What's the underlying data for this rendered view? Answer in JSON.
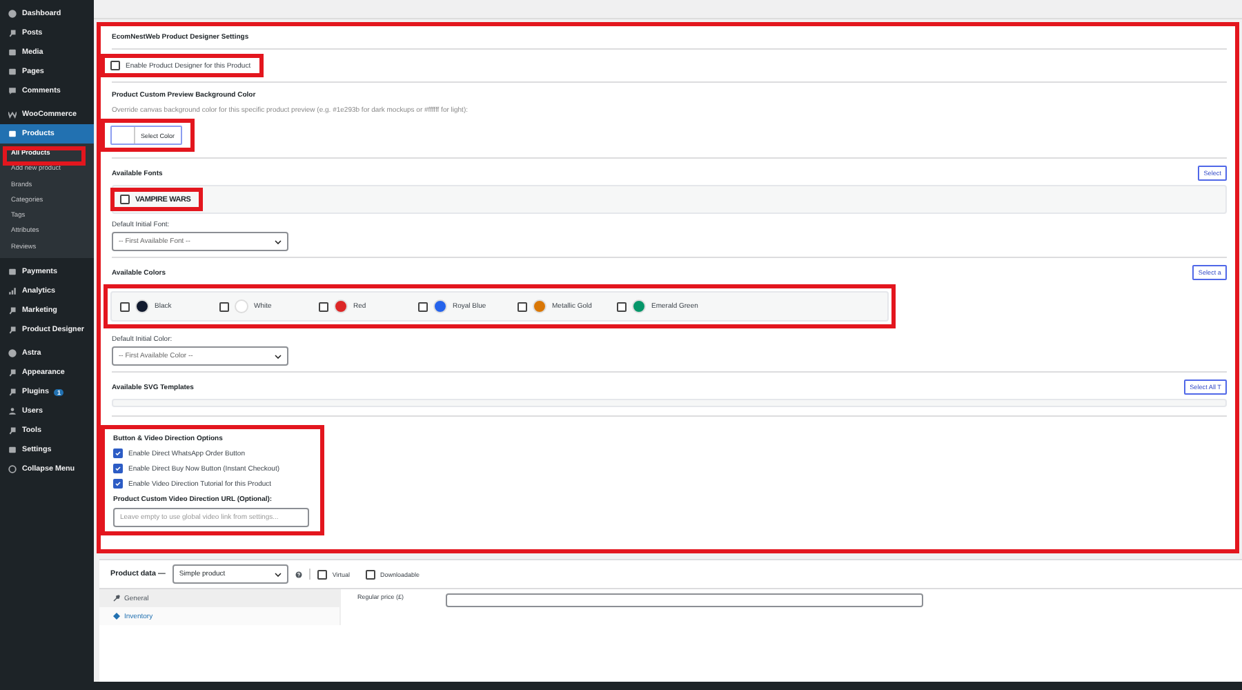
{
  "sidebar": {
    "items": [
      {
        "label": "Dashboard",
        "selected": false
      },
      {
        "label": "Posts",
        "selected": false
      },
      {
        "label": "Media",
        "selected": false
      },
      {
        "label": "Pages",
        "selected": false
      },
      {
        "label": "Comments",
        "selected": false
      },
      {
        "label": "WooCommerce",
        "selected": false
      },
      {
        "label": "Products",
        "selected": true,
        "children": [
          {
            "label": "All Products",
            "selected": true
          },
          {
            "label": "Add new product",
            "selected": false
          },
          {
            "label": "Brands",
            "selected": false
          },
          {
            "label": "Categories",
            "selected": false
          },
          {
            "label": "Tags",
            "selected": false
          },
          {
            "label": "Attributes",
            "selected": false
          },
          {
            "label": "Reviews",
            "selected": false
          }
        ]
      },
      {
        "label": "Payments",
        "selected": false
      },
      {
        "label": "Analytics",
        "selected": false
      },
      {
        "label": "Marketing",
        "selected": false
      },
      {
        "label": "Product Designer",
        "selected": false
      },
      {
        "label": "Astra",
        "selected": false
      },
      {
        "label": "Appearance",
        "selected": false
      },
      {
        "label": "Plugins",
        "selected": false,
        "badge": "1"
      },
      {
        "label": "Users",
        "selected": false
      },
      {
        "label": "Tools",
        "selected": false
      },
      {
        "label": "Settings",
        "selected": false
      },
      {
        "label": "Collapse Menu",
        "selected": false
      }
    ]
  },
  "panel": {
    "title": "EcomNestWeb Product Designer Settings",
    "enable": {
      "label": "Enable Product Designer for this Product",
      "checked": false
    },
    "bg_color": {
      "heading": "Product Custom Preview Background Color",
      "hint": "Override canvas background color for this specific product preview (e.g. #1e293b for dark mockups or #ffffff for light):",
      "button": "Select Color"
    },
    "fonts": {
      "heading": "Available Fonts",
      "select_button": "Select",
      "items": [
        {
          "label": "VAMPIRE WARS",
          "checked": false
        }
      ],
      "default_label": "Default Initial Font:",
      "default_value": "-- First Available Font --"
    },
    "colors": {
      "heading": "Available Colors",
      "select_button": "Select a",
      "items": [
        {
          "label": "Black",
          "color": "#111a2e",
          "checked": false
        },
        {
          "label": "White",
          "color": "#ffffff",
          "checked": false
        },
        {
          "label": "Red",
          "color": "#dc2626",
          "checked": false
        },
        {
          "label": "Royal Blue",
          "color": "#2563eb",
          "checked": false
        },
        {
          "label": "Metallic Gold",
          "color": "#d97706",
          "checked": false
        },
        {
          "label": "Emerald Green",
          "color": "#059669",
          "checked": false
        }
      ],
      "default_label": "Default Initial Color:",
      "default_value": "-- First Available Color --"
    },
    "svg": {
      "heading": "Available SVG Templates",
      "select_button": "Select All T"
    },
    "options": {
      "heading": "Button & Video Direction Options",
      "items": [
        {
          "label": "Enable Direct WhatsApp Order Button",
          "checked": true
        },
        {
          "label": "Enable Direct Buy Now Button (Instant Checkout)",
          "checked": true
        },
        {
          "label": "Enable Video Direction Tutorial for this Product",
          "checked": true
        }
      ],
      "url_label": "Product Custom Video Direction URL (Optional):",
      "url_placeholder": "Leave empty to use global video link from settings..."
    }
  },
  "product_data": {
    "label": "Product data —",
    "type": "Simple product",
    "flags": [
      {
        "label": "Virtual",
        "checked": false
      },
      {
        "label": "Downloadable",
        "checked": false
      }
    ],
    "tabs": [
      {
        "label": "General",
        "selected": true
      },
      {
        "label": "Inventory",
        "selected": false
      }
    ],
    "price_label": "Regular price (£)"
  }
}
